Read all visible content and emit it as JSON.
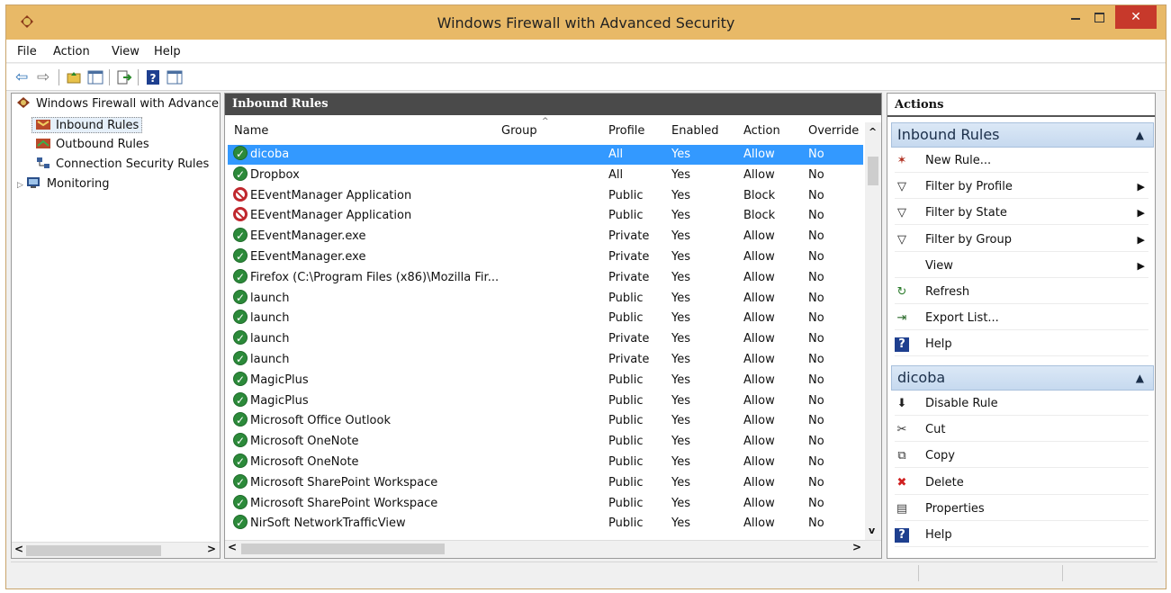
{
  "window": {
    "title": "Windows Firewall with Advanced Security",
    "close_glyph": "✕"
  },
  "menu": [
    "File",
    "Action",
    "View",
    "Help"
  ],
  "toolbar": {
    "back_glyph": "⇦",
    "forward_glyph": "⇨",
    "icons": [
      "back-icon",
      "forward-icon",
      "up-folder-icon",
      "show-hide-tree-icon",
      "export-list-icon",
      "help-icon",
      "show-hide-action-pane-icon"
    ]
  },
  "nav": {
    "root": "Windows Firewall with Advanced Security",
    "items": [
      "Inbound Rules",
      "Outbound Rules",
      "Connection Security Rules",
      "Monitoring"
    ],
    "expand_glyph": "▷",
    "left_arrow": "<",
    "right_arrow": ">"
  },
  "rules_pane": {
    "title": "Inbound Rules",
    "columns": [
      "Name",
      "Group",
      "Profile",
      "Enabled",
      "Action",
      "Override"
    ],
    "sort_glyph": "^",
    "up_arrow": "^",
    "down_arrow": "v",
    "left_arrow": "<",
    "right_arrow": ">",
    "rows": [
      {
        "name": "dicoba",
        "profile": "All",
        "enabled": "Yes",
        "action": "Allow",
        "override": "No",
        "status": "allow",
        "selected": true
      },
      {
        "name": "Dropbox",
        "profile": "All",
        "enabled": "Yes",
        "action": "Allow",
        "override": "No",
        "status": "allow"
      },
      {
        "name": "EEventManager Application",
        "profile": "Public",
        "enabled": "Yes",
        "action": "Block",
        "override": "No",
        "status": "block"
      },
      {
        "name": "EEventManager Application",
        "profile": "Public",
        "enabled": "Yes",
        "action": "Block",
        "override": "No",
        "status": "block"
      },
      {
        "name": "EEventManager.exe",
        "profile": "Private",
        "enabled": "Yes",
        "action": "Allow",
        "override": "No",
        "status": "allow"
      },
      {
        "name": "EEventManager.exe",
        "profile": "Private",
        "enabled": "Yes",
        "action": "Allow",
        "override": "No",
        "status": "allow"
      },
      {
        "name": "Firefox (C:\\Program Files (x86)\\Mozilla Fir...",
        "profile": "Private",
        "enabled": "Yes",
        "action": "Allow",
        "override": "No",
        "status": "allow"
      },
      {
        "name": "launch",
        "profile": "Public",
        "enabled": "Yes",
        "action": "Allow",
        "override": "No",
        "status": "allow"
      },
      {
        "name": "launch",
        "profile": "Public",
        "enabled": "Yes",
        "action": "Allow",
        "override": "No",
        "status": "allow"
      },
      {
        "name": "launch",
        "profile": "Private",
        "enabled": "Yes",
        "action": "Allow",
        "override": "No",
        "status": "allow"
      },
      {
        "name": "launch",
        "profile": "Private",
        "enabled": "Yes",
        "action": "Allow",
        "override": "No",
        "status": "allow"
      },
      {
        "name": "MagicPlus",
        "profile": "Public",
        "enabled": "Yes",
        "action": "Allow",
        "override": "No",
        "status": "allow"
      },
      {
        "name": "MagicPlus",
        "profile": "Public",
        "enabled": "Yes",
        "action": "Allow",
        "override": "No",
        "status": "allow"
      },
      {
        "name": "Microsoft Office Outlook",
        "profile": "Public",
        "enabled": "Yes",
        "action": "Allow",
        "override": "No",
        "status": "allow"
      },
      {
        "name": "Microsoft OneNote",
        "profile": "Public",
        "enabled": "Yes",
        "action": "Allow",
        "override": "No",
        "status": "allow"
      },
      {
        "name": "Microsoft OneNote",
        "profile": "Public",
        "enabled": "Yes",
        "action": "Allow",
        "override": "No",
        "status": "allow"
      },
      {
        "name": "Microsoft SharePoint Workspace",
        "profile": "Public",
        "enabled": "Yes",
        "action": "Allow",
        "override": "No",
        "status": "allow"
      },
      {
        "name": "Microsoft SharePoint Workspace",
        "profile": "Public",
        "enabled": "Yes",
        "action": "Allow",
        "override": "No",
        "status": "allow"
      },
      {
        "name": "NirSoft NetworkTrafficView",
        "profile": "Public",
        "enabled": "Yes",
        "action": "Allow",
        "override": "No",
        "status": "allow"
      }
    ]
  },
  "actions_pane": {
    "title": "Actions",
    "section1": {
      "title": "Inbound Rules",
      "caret": "▲",
      "items": [
        {
          "label": "New Rule...",
          "icon": "new-rule-icon",
          "glyph": "✶",
          "color": "#b03020"
        },
        {
          "label": "Filter by Profile",
          "icon": "filter-icon",
          "glyph": "▽",
          "color": "#222",
          "sub": "▶"
        },
        {
          "label": "Filter by State",
          "icon": "filter-icon",
          "glyph": "▽",
          "color": "#222",
          "sub": "▶"
        },
        {
          "label": "Filter by Group",
          "icon": "filter-icon",
          "glyph": "▽",
          "color": "#222",
          "sub": "▶"
        },
        {
          "label": "View",
          "icon": "",
          "glyph": "",
          "color": "#222",
          "sub": "▶"
        },
        {
          "label": "Refresh",
          "icon": "refresh-icon",
          "glyph": "↻",
          "color": "#2a7a2a"
        },
        {
          "label": "Export List...",
          "icon": "export-list-icon",
          "glyph": "⇥",
          "color": "#2a6a2a"
        },
        {
          "label": "Help",
          "icon": "help-icon",
          "glyph": "?",
          "color": "#fff"
        }
      ]
    },
    "section2": {
      "title": "dicoba",
      "caret": "▲",
      "items": [
        {
          "label": "Disable Rule",
          "icon": "disable-rule-icon",
          "glyph": "⬇",
          "color": "#222"
        },
        {
          "label": "Cut",
          "icon": "cut-icon",
          "glyph": "✂",
          "color": "#333"
        },
        {
          "label": "Copy",
          "icon": "copy-icon",
          "glyph": "⧉",
          "color": "#333"
        },
        {
          "label": "Delete",
          "icon": "delete-icon",
          "glyph": "✖",
          "color": "#d02020"
        },
        {
          "label": "Properties",
          "icon": "properties-icon",
          "glyph": "▤",
          "color": "#444"
        },
        {
          "label": "Help",
          "icon": "help-icon",
          "glyph": "?",
          "color": "#fff"
        }
      ]
    }
  },
  "colors": {
    "titlebar": "#e8b967",
    "selection": "#3399ff",
    "allow": "#2c8a3a",
    "block": "#c0272d",
    "pane_header": "#4a4a4a",
    "section_header": "#c6d9ef"
  }
}
